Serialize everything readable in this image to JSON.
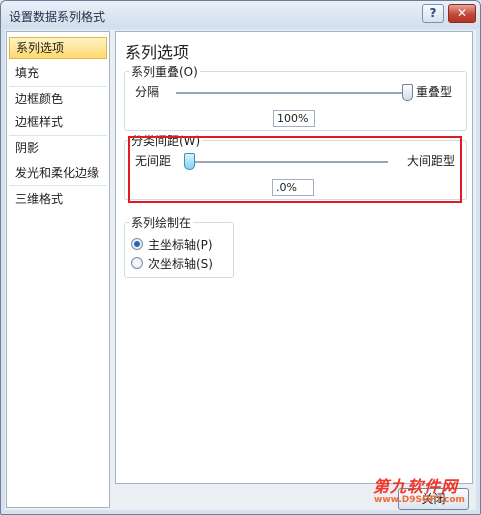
{
  "window": {
    "title": "设置数据系列格式",
    "help_glyph": "?",
    "close_glyph": "✕"
  },
  "nav": {
    "items": [
      "系列选项",
      "填充",
      "边框颜色",
      "边框样式",
      "阴影",
      "发光和柔化边缘",
      "三维格式"
    ],
    "selected_index": 0
  },
  "panel": {
    "title": "系列选项",
    "overlap": {
      "label": "系列重叠(O)",
      "left_label": "分隔",
      "right_label": "重叠型",
      "value": "100%",
      "level": 1.0
    },
    "gap": {
      "label": "分类间距(W)",
      "left_label": "无间距",
      "right_label": "大间距型",
      "value": ".0%",
      "level": 0.0
    },
    "plot_on": {
      "label": "系列绘制在",
      "options": [
        "主坐标轴(P)",
        "次坐标轴(S)"
      ],
      "selected_index": 0
    }
  },
  "footer": {
    "close_label": "关闭"
  },
  "watermark": {
    "text": "第九软件网",
    "url": "www.D9SOFT.com"
  },
  "colors": {
    "highlight": "#e01b24",
    "selected_nav": "#ffd86f"
  }
}
